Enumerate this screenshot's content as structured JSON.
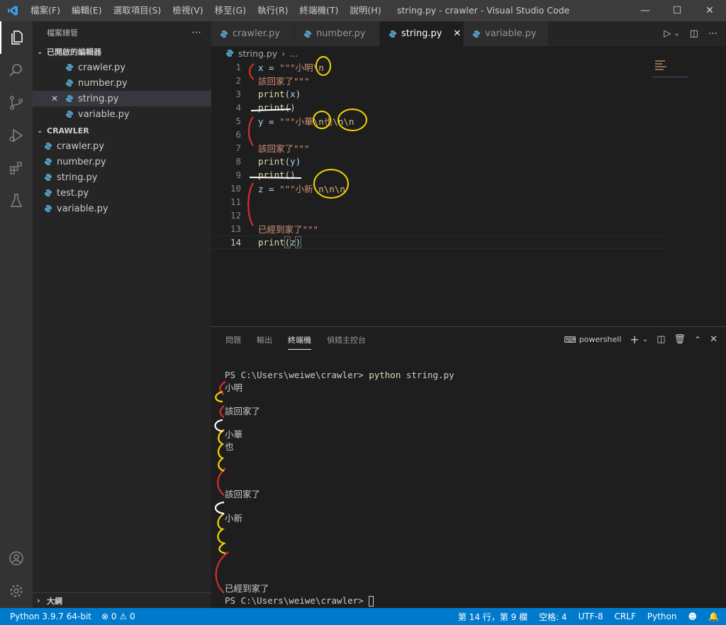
{
  "titlebar": {
    "menus": [
      "檔案(F)",
      "編輯(E)",
      "選取項目(S)",
      "檢視(V)",
      "移至(G)",
      "執行(R)",
      "終端機(T)",
      "說明(H)"
    ],
    "title": "string.py - crawler - Visual Studio Code"
  },
  "sidebar": {
    "header": "檔案總管",
    "open_editors_label": "已開啟的編輯器",
    "open_editors": [
      "crawler.py",
      "number.py",
      "string.py",
      "variable.py"
    ],
    "folder_label": "CRAWLER",
    "files": [
      "crawler.py",
      "number.py",
      "string.py",
      "test.py",
      "variable.py"
    ],
    "outline_label": "大綱"
  },
  "tabs": [
    {
      "label": "crawler.py"
    },
    {
      "label": "number.py"
    },
    {
      "label": "string.py"
    },
    {
      "label": "variable.py"
    }
  ],
  "breadcrumb": {
    "file": "string.py",
    "more": "..."
  },
  "editor": {
    "line_numbers": [
      "1",
      "2",
      "3",
      "4",
      "5",
      "6",
      "7",
      "8",
      "9",
      "10",
      "11",
      "12",
      "13",
      "14"
    ],
    "current_line": "14",
    "code": {
      "l1": {
        "a": "x",
        "b": " = ",
        "c": "\"\"\"小明",
        "d": "\\n"
      },
      "l2": {
        "a": "該回家了\"\"\""
      },
      "l3": {
        "a": "print",
        "b": "(",
        "c": "x",
        "d": ")"
      },
      "l4": {
        "a": "print",
        "b": "()"
      },
      "l5": {
        "a": "y",
        "b": " = ",
        "c": "\"\"\"小華",
        "d": "\\n",
        "e": "也",
        "f": "\\n\\n"
      },
      "l7": {
        "a": "該回家了\"\"\""
      },
      "l8": {
        "a": "print",
        "b": "(",
        "c": "y",
        "d": ")"
      },
      "l9": {
        "a": "print",
        "b": "()"
      },
      "l10": {
        "a": "z",
        "b": " = ",
        "c": "\"\"\"小新",
        "d": "\\n\\n\\n"
      },
      "l13": {
        "a": "已經到家了\"\"\""
      },
      "l14": {
        "a": "print",
        "b": "(",
        "c": "z",
        "d": ")"
      }
    }
  },
  "panel": {
    "tabs": [
      "問題",
      "輸出",
      "終端機",
      "偵錯主控台"
    ],
    "active_tab": "終端機",
    "shell": "powershell",
    "terminal": {
      "prompt": "PS C:\\Users\\weiwe\\crawler> ",
      "command": "python",
      "args": " string.py",
      "out1": "小明",
      "out2": "該回家了",
      "out3": "小華",
      "out4": "也",
      "out5": "該回家了",
      "out6": "小新",
      "out7": "已經到家了",
      "prompt2": "PS C:\\Users\\weiwe\\crawler> "
    }
  },
  "statusbar": {
    "python": "Python 3.9.7 64-bit",
    "errors": "0",
    "warnings": "0",
    "position": "第 14 行，第 9 欄",
    "spaces": "空格: 4",
    "encoding": "UTF-8",
    "eol": "CRLF",
    "language": "Python"
  },
  "colors": {
    "statusbar": "#007acc",
    "annotation_red": "#d32f2f",
    "annotation_yellow": "#f2d600",
    "annotation_white": "#ffffff"
  }
}
